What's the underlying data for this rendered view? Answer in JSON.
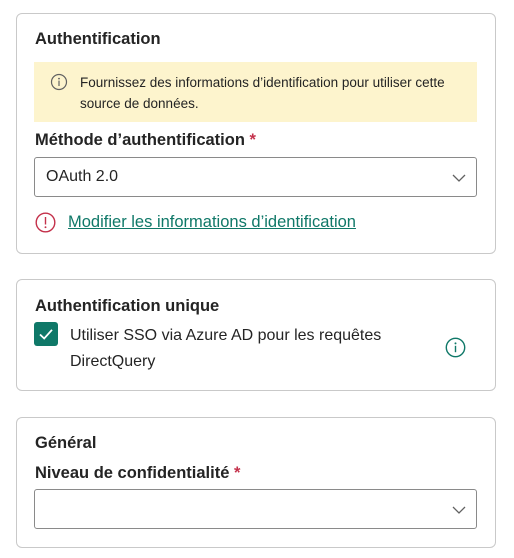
{
  "auth_section": {
    "title": "Authentification",
    "info_banner": "Fournissez des informations d’identification pour utiliser cette source de données.",
    "method_label": "Méthode d’authentification",
    "required_marker": "*",
    "method_value": "OAuth 2.0",
    "edit_credentials_link": "Modifier les informations d’identification"
  },
  "sso_section": {
    "title": "Authentification unique",
    "checkbox_label": "Utiliser SSO via Azure AD pour les requêtes DirectQuery",
    "checkbox_checked": true
  },
  "general_section": {
    "title": "Général",
    "privacy_label": "Niveau de confidentialité",
    "required_marker": "*",
    "privacy_value": ""
  },
  "icons": {
    "info": "info-icon",
    "error": "error-circle-icon",
    "chevron": "chevron-down-icon",
    "check": "checkmark-icon"
  },
  "colors": {
    "accent": "#0f7868",
    "required": "#c4314b",
    "error": "#c4314b",
    "banner_bg": "#fdf4cd",
    "border": "#c9c9c9"
  }
}
